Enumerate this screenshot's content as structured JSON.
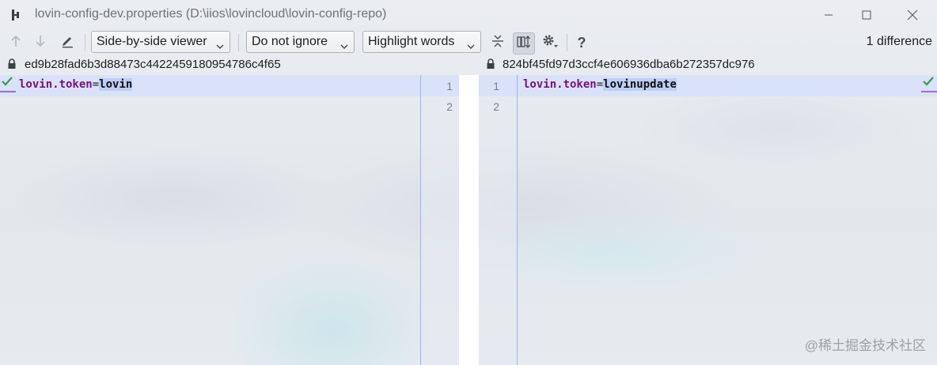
{
  "window": {
    "title": "lovin-config-dev.properties (D:\\iios\\lovincloud\\lovin-config-repo)"
  },
  "toolbar": {
    "viewer_mode": "Side-by-side viewer",
    "whitespace_mode": "Do not ignore",
    "highlight_mode": "Highlight words",
    "difference_count": "1 difference",
    "help_label": "?"
  },
  "left": {
    "revision": "ed9b28fad6b3d88473c4422459180954786c4f65",
    "lines": [
      {
        "number": "1",
        "key": "lovin.token",
        "sep": "=",
        "value": "lovin"
      },
      {
        "number": "2",
        "key": "",
        "sep": "",
        "value": ""
      }
    ]
  },
  "right": {
    "revision": "824bf45fd97d3ccf4e606936dba6b272357dc976",
    "lines": [
      {
        "number": "1",
        "key": "lovin.token",
        "sep": "=",
        "value": "lovinupdate"
      },
      {
        "number": "2",
        "key": "",
        "sep": "",
        "value": ""
      }
    ]
  },
  "watermark": "@稀土掘金技术社区",
  "colors": {
    "changed_line": "#d6e0fa",
    "changed_word": "#becdf5",
    "key_color": "#7a0f7a",
    "check_green": "#3a9a4a",
    "marker_purple": "#9c6fd0"
  },
  "icons": {
    "prev_diff": "arrow-up-icon",
    "next_diff": "arrow-down-icon",
    "edit": "pencil-icon",
    "collapse": "collapse-unchanged-icon",
    "sync_scroll": "sync-scroll-icon",
    "settings": "gear-icon",
    "lock": "lock-icon",
    "check": "check-icon"
  }
}
